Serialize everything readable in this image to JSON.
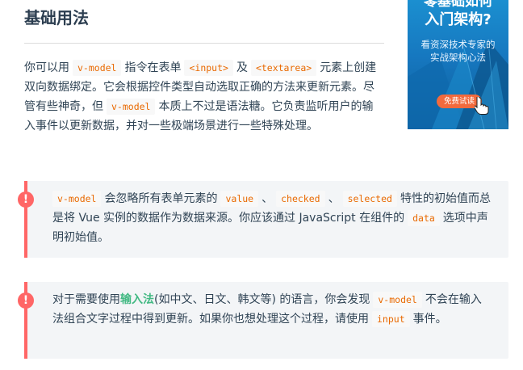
{
  "section": {
    "title": "基础用法"
  },
  "intro": {
    "t1": "你可以用",
    "c1": "v-model",
    "t2": "指令在表单",
    "c2": "<input>",
    "t3": "及",
    "c3": "<textarea>",
    "t4": "元素上创建双向数据绑定。它会根据控件类型自动选取正确的方法来更新元素。尽管有些神奇，但",
    "c4": "v-model",
    "t5": "本质上不过是语法糖。它负责监听用户的输入事件以更新数据，并对一些极端场景进行一些特殊处理。"
  },
  "tip1": {
    "icon": "!",
    "c1": "v-model",
    "t1": "会忽略所有表单元素的",
    "c2": "value",
    "t2": "、",
    "c3": "checked",
    "t3": "、",
    "c4": "selected",
    "t4": "特性的初始值而总是将 Vue 实例的数据作为数据来源。你应该通过 JavaScript 在组件的",
    "c5": "data",
    "t5": "选项中声明初始值。"
  },
  "tip2": {
    "icon": "!",
    "t1": "对于需要使用",
    "link": "输入法",
    "t2": "(如中文、日文、韩文等) 的语言，你会发现",
    "c1": "v-model",
    "t3": "不会在输入法组合文字过程中得到更新。如果你也想处理这个过程，请使用",
    "c2": "input",
    "t4": "事件。"
  },
  "ad": {
    "title_line1": "零基础如何",
    "title_line2": "入门架构?",
    "subtitle_line1": "看资深技术专家的",
    "subtitle_line2": "实战架构心法",
    "button": "免费试读"
  },
  "colors": {
    "accent_green": "#42b983",
    "warning_red": "#ff6666",
    "code_orange": "#e96900",
    "ad_blue": "#1677bf",
    "ad_button": "#f26a3d"
  }
}
